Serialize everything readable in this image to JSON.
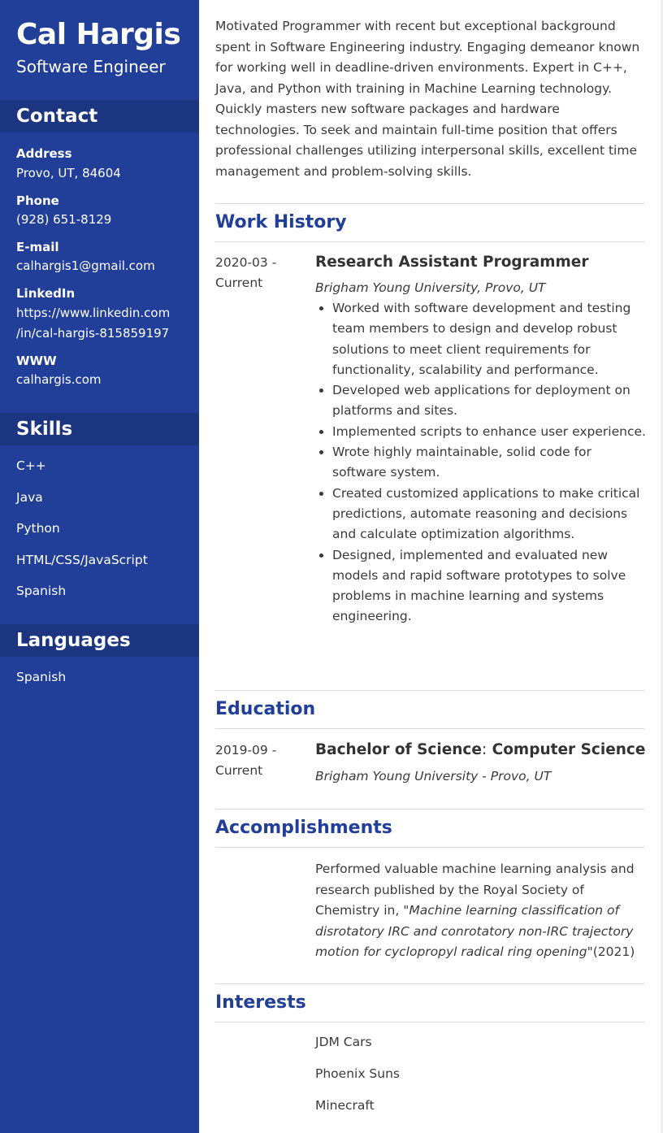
{
  "header": {
    "name": "Cal Hargis",
    "title": "Software Engineer"
  },
  "contact": {
    "heading": "Contact",
    "address_label": "Address",
    "address": "Provo, UT, 84604",
    "phone_label": "Phone",
    "phone": "(928) 651-8129",
    "email_label": "E-mail",
    "email": "calhargis1@gmail.com",
    "linkedin_label": "LinkedIn",
    "linkedin_line1": "https://www.linkedin.com",
    "linkedin_line2": "/in/cal-hargis-815859197",
    "www_label": "WWW",
    "www": "calhargis.com"
  },
  "skills": {
    "heading": "Skills",
    "items": [
      "C++",
      "Java",
      "Python",
      "HTML/CSS/JavaScript",
      "Spanish"
    ]
  },
  "languages": {
    "heading": "Languages",
    "items": [
      "Spanish"
    ]
  },
  "summary": "Motivated Programmer with recent but exceptional background spent in Software Engineering industry. Engaging demeanor known for working well in deadline-driven environments. Expert in C++, Java, and Python with training in Machine Learning technology. Quickly masters new software packages and hardware technologies. To seek and maintain full-time position that offers professional challenges utilizing interpersonal skills, excellent time management and problem-solving skills.",
  "work": {
    "heading": "Work History",
    "date_start": "2020-03 -",
    "date_end": "Current",
    "job_title": "Research Assistant Programmer",
    "employer": "Brigham Young University, Provo, UT",
    "bullets": [
      "Worked with software development and testing team members to design and develop robust solutions to meet client requirements for functionality, scalability and performance.",
      "Developed web applications for deployment on platforms and sites.",
      "Implemented scripts to enhance user experience.",
      "Wrote highly maintainable, solid code for software system.",
      "Created customized applications to make critical predictions, automate reasoning and decisions and calculate optimization algorithms.",
      "Designed, implemented and evaluated new models and rapid software prototypes to solve problems in machine learning and systems engineering."
    ]
  },
  "education": {
    "heading": "Education",
    "date_start": "2019-09 -",
    "date_end": "Current",
    "degree": "Bachelor of Science",
    "separator": ":",
    "field": "Computer Science",
    "school": "Brigham Young University - Provo, UT"
  },
  "accomplishments": {
    "heading": "Accomplishments",
    "text_prefix": "Performed valuable machine learning analysis and research published by the Royal Society of Chemistry in, \"",
    "text_title": "Machine learning classification of disrotatory IRC and conrotatory non-IRC trajectory motion for cyclopropyl radical ring opening",
    "text_suffix": "\"(2021)"
  },
  "interests": {
    "heading": "Interests",
    "items": [
      "JDM Cars",
      "Phoenix Suns",
      "Minecraft"
    ]
  },
  "colors": {
    "sidebar": "#213f99",
    "sidebar_heading": "#1c3580",
    "accent": "#213f99"
  }
}
